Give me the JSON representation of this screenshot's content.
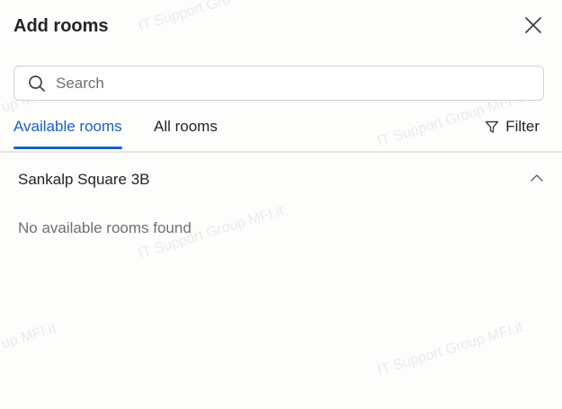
{
  "panel": {
    "title": "Add rooms",
    "close_icon": "close-icon"
  },
  "search": {
    "placeholder": "Search",
    "value": "",
    "icon": "search-icon"
  },
  "tabs": [
    {
      "label": "Available rooms",
      "active": true
    },
    {
      "label": "All rooms",
      "active": false
    }
  ],
  "filter": {
    "label": "Filter",
    "icon": "filter-icon"
  },
  "section": {
    "title": "Sankalp Square 3B",
    "expanded": true,
    "empty_message": "No available rooms found"
  },
  "watermark": {
    "text_1": "IT Support Gro",
    "text_2": "up MFI.it",
    "text_3": "IT Support Group MFI.it",
    "text_4": "IT Support Group MFI.it",
    "text_5": "up MFI.it",
    "text_6": "IT Support Group MFI.it"
  },
  "colors": {
    "accent": "#1a5fcc",
    "text": "#242424",
    "muted": "#707070",
    "border": "#d1d1d1"
  }
}
